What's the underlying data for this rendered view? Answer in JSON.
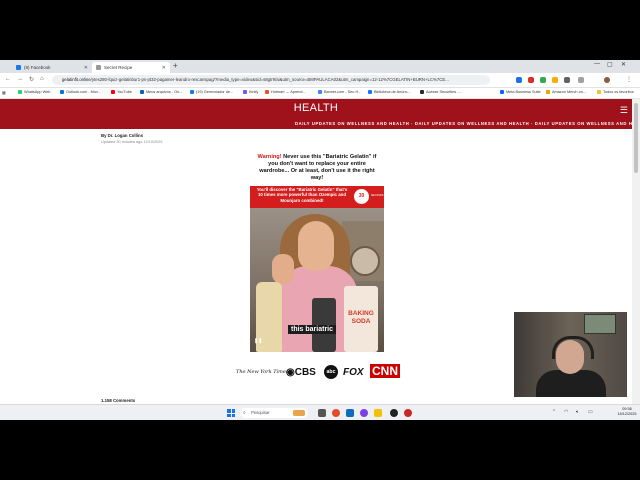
{
  "browser": {
    "tabs": [
      {
        "label": "(8) Facebook",
        "active": false,
        "favicon_color": "#1877f2"
      },
      {
        "label": "Secret Recipe",
        "active": true,
        "favicon_color": "#999999"
      }
    ],
    "url_host": "gelatinfit.online",
    "url_rest": "/ytes280-fquiz-gelatinbur1-ps-pt32-pagamer-leandro-rescanspag/?media_type=video&sid=s8gtr9/ai&utm_source=BMPAULACA02&utm_campaign=12-12%7CGELATIN+BURN+LC%7CE...",
    "bookmarks": [
      {
        "label": "WhatsApp Web",
        "color": "#25d366"
      },
      {
        "label": "Outlook.com - Micr...",
        "color": "#0078d4"
      },
      {
        "label": "YouTube",
        "color": "#ff0000"
      },
      {
        "label": "Meus arquivos - On...",
        "color": "#0364b8"
      },
      {
        "label": "(19) Gerenciador de...",
        "color": "#1877f2"
      },
      {
        "label": "Kinify",
        "color": "#7a52f4"
      },
      {
        "label": "Hotmart → Aprend...",
        "color": "#f04e23"
      },
      {
        "label": "Banner.com - Seu H...",
        "color": "#4285f4"
      },
      {
        "label": "Biblioteca de Anúnc...",
        "color": "#1877f2"
      },
      {
        "label": "Acesse Securities -...",
        "color": "#2b2b2b"
      },
      {
        "label": "Meta Business Suite",
        "color": "#0866ff"
      },
      {
        "label": "Amazon Merch on...",
        "color": "#ff9900"
      }
    ],
    "all_favorites_label": "Todos os favoritos"
  },
  "site": {
    "brand": "HEALTH",
    "ticker": "DAILY UPDATES ON WELLNESS AND HEALTH · DAILY UPDATES ON WELLNESS AND HEALTH · DAILY UPDATES ON WELLNESS AND HEALTH · DAILY UPDATES ON WELLNESS AND HEALTH · DAILY",
    "byline": "By Dr. Logan Collins",
    "dateline": "Updated 30 minutes ago 12/10/2025",
    "headline_warning": "Warning!",
    "headline_rest": "Never use this \"Bariatric Gelatin\" if you don't want to replace your entire wardrobe... Or at least, don't use it the right way!",
    "video": {
      "banner": "You'll discover the \"Bariatric Gelatin\" that's 10 times more powerful than Ozempic and Mounjaro combined!",
      "countdown": "30",
      "countdown_sub": "SECONDS",
      "caption": "this bariatric",
      "soda_label": "BAKING SODA"
    },
    "press_logos": [
      "The New York Times",
      "CBS",
      "abc",
      "FOX",
      "CNN"
    ],
    "comments": "1.158 Comments"
  },
  "taskbar": {
    "search_placeholder": "Pesquisar",
    "time": "09:36",
    "date": "16/12/2025",
    "tray_lang": "POR"
  }
}
